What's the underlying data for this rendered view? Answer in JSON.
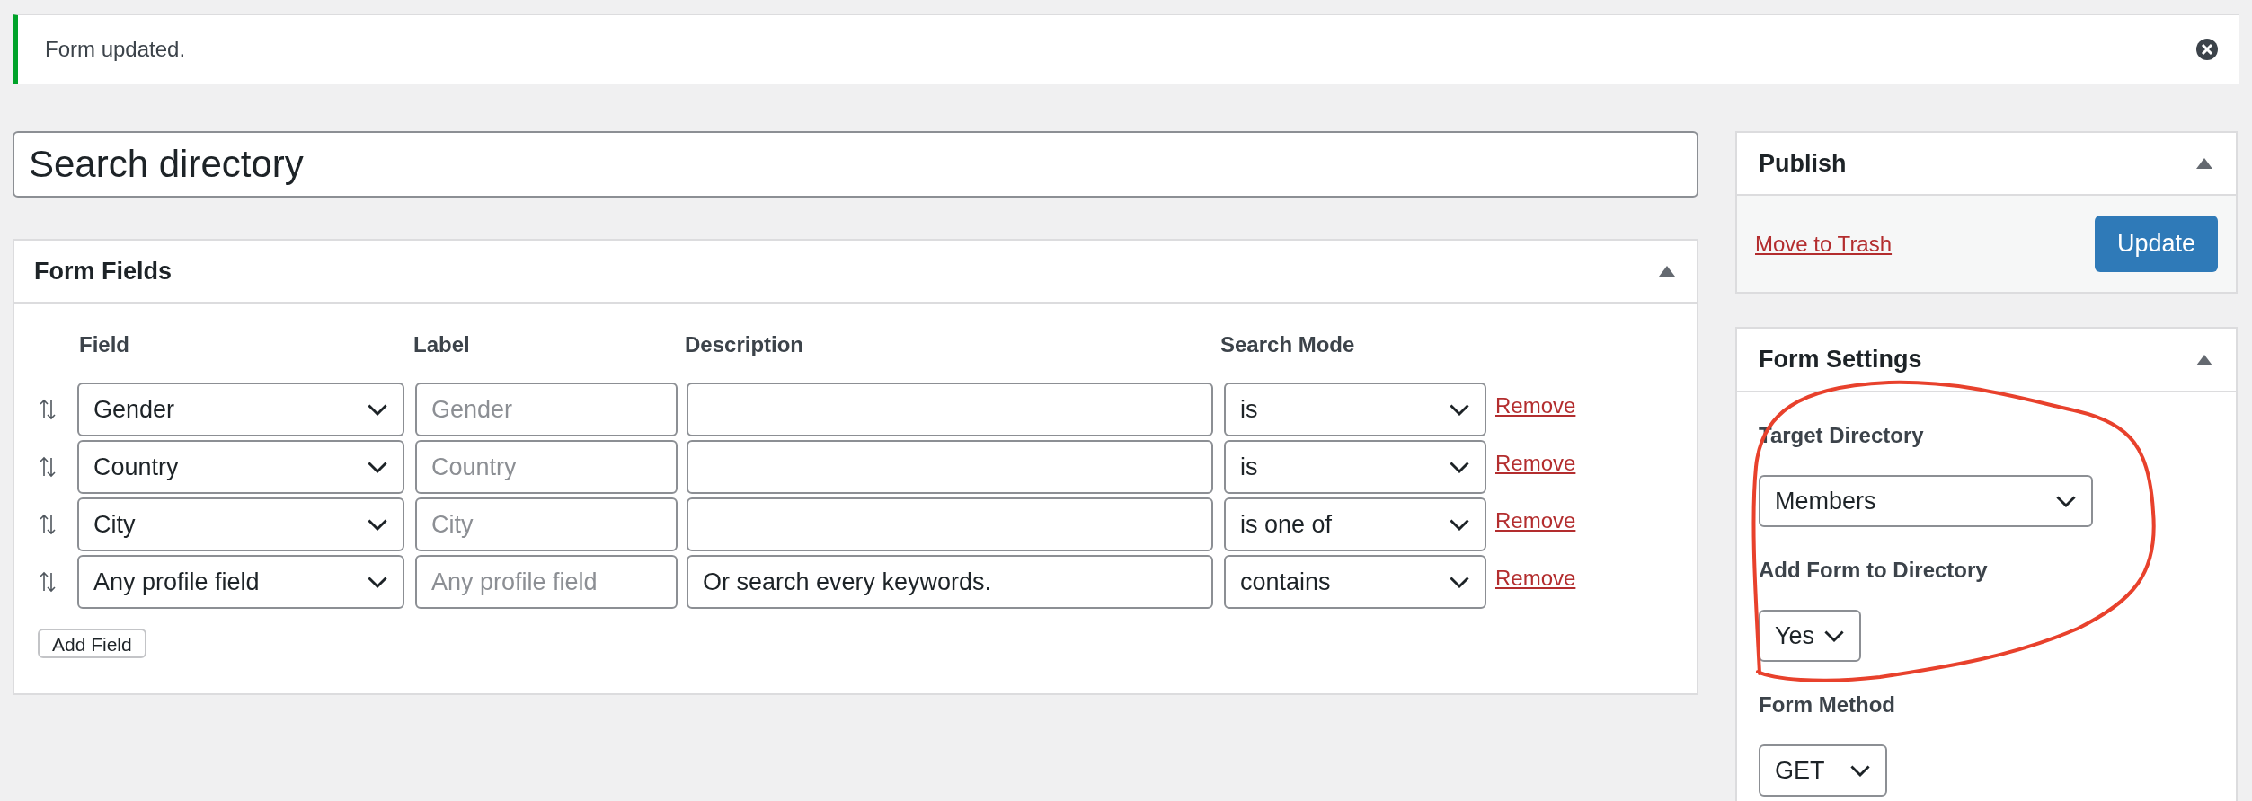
{
  "notice": {
    "text": "Form updated."
  },
  "title_field": {
    "value": "Search directory"
  },
  "form_fields": {
    "title": "Form Fields",
    "columns": [
      "Field",
      "Label",
      "Description",
      "Search Mode"
    ],
    "rows": [
      {
        "field": "Gender",
        "label": {
          "placeholder": "Gender"
        },
        "search_mode": "is",
        "action": "Remove"
      },
      {
        "field": "Country",
        "label": {
          "placeholder": "Country"
        },
        "search_mode": "is",
        "action": "Remove"
      },
      {
        "field": "City",
        "label": {
          "placeholder": "City"
        },
        "search_mode": "is one of",
        "action": "Remove"
      },
      {
        "field": "Any profile field",
        "label": {
          "placeholder": "Any profile field"
        },
        "description": {
          "value": "Or search every keywords."
        },
        "search_mode": "contains",
        "action": "Remove"
      }
    ],
    "add_button": "Add Field"
  },
  "publish": {
    "title": "Publish",
    "trash_link": "Move to Trash",
    "update_button": "Update"
  },
  "form_settings": {
    "title": "Form Settings",
    "settings": [
      {
        "label": "Target Directory",
        "value": "Members"
      },
      {
        "label": "Add Form to Directory",
        "value": "Yes"
      },
      {
        "label": "Form Method",
        "value": "GET"
      }
    ]
  }
}
